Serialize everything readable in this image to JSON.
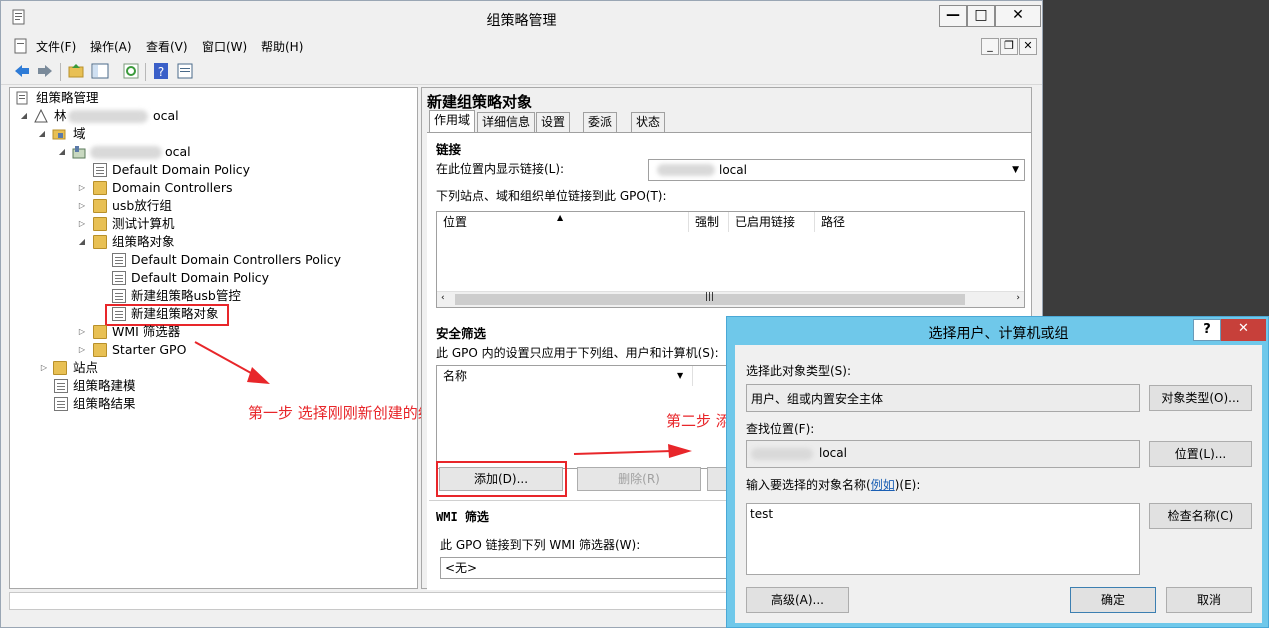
{
  "window": {
    "title": "组策略管理",
    "menu": [
      "文件(F)",
      "操作(A)",
      "查看(V)",
      "窗口(W)",
      "帮助(H)"
    ],
    "caption": {
      "minimize": "—",
      "maximize": "□",
      "close": "✕"
    },
    "mdi": {
      "minimize": "_",
      "restore": "❐",
      "close": "✕"
    }
  },
  "tree": {
    "root": "组策略管理",
    "forest_suffix": "ocal",
    "forest_prefix": "林",
    "domains": "域",
    "domain_suffix": "ocal",
    "items": [
      "Default Domain Policy",
      "Domain Controllers",
      "usb放行组",
      "测试计算机",
      "组策略对象",
      "Default Domain Controllers Policy",
      "Default Domain Policy",
      "新建组策略usb管控",
      "新建组策略对象",
      "WMI 筛选器",
      "Starter GPO",
      "站点",
      "组策略建模",
      "组策略结果"
    ]
  },
  "right": {
    "title": "新建组策略对象",
    "tabs": [
      "作用域",
      "详细信息",
      "设置",
      "委派",
      "状态"
    ],
    "links": {
      "heading": "链接",
      "display_label": "在此位置内显示链接(L):",
      "location_suffix": "local",
      "list_label": "下列站点、域和组织单位链接到此 GPO(T):",
      "columns": [
        "位置",
        "强制",
        "已启用链接",
        "路径"
      ]
    },
    "security": {
      "heading": "安全筛选",
      "desc": "此 GPO 内的设置只应用于下列组、用户和计算机(S):",
      "column": "名称",
      "add": "添加(D)...",
      "remove": "删除(R)"
    },
    "wmi": {
      "heading": "WMI 筛选",
      "desc": "此 GPO 链接到下列 WMI 筛选器(W):",
      "value": "<无>"
    }
  },
  "annotations": {
    "step1": "第一步 选择刚刚新创建的组策略",
    "step2": "第二步 添加要应用组策略的用户"
  },
  "dialog": {
    "title": "选择用户、计算机或组",
    "help": "?",
    "close": "✕",
    "obj_type_label": "选择此对象类型(S):",
    "obj_type_value": "用户、组或内置安全主体",
    "obj_type_btn": "对象类型(O)...",
    "location_label": "查找位置(F):",
    "location_suffix": "local",
    "location_btn": "位置(L)...",
    "names_label_pre": "输入要选择的对象名称(",
    "names_link": "例如",
    "names_label_post": ")(E):",
    "names_value": "test",
    "check_btn": "检查名称(C)",
    "advanced_btn": "高级(A)...",
    "ok_btn": "确定",
    "cancel_btn": "取消"
  }
}
